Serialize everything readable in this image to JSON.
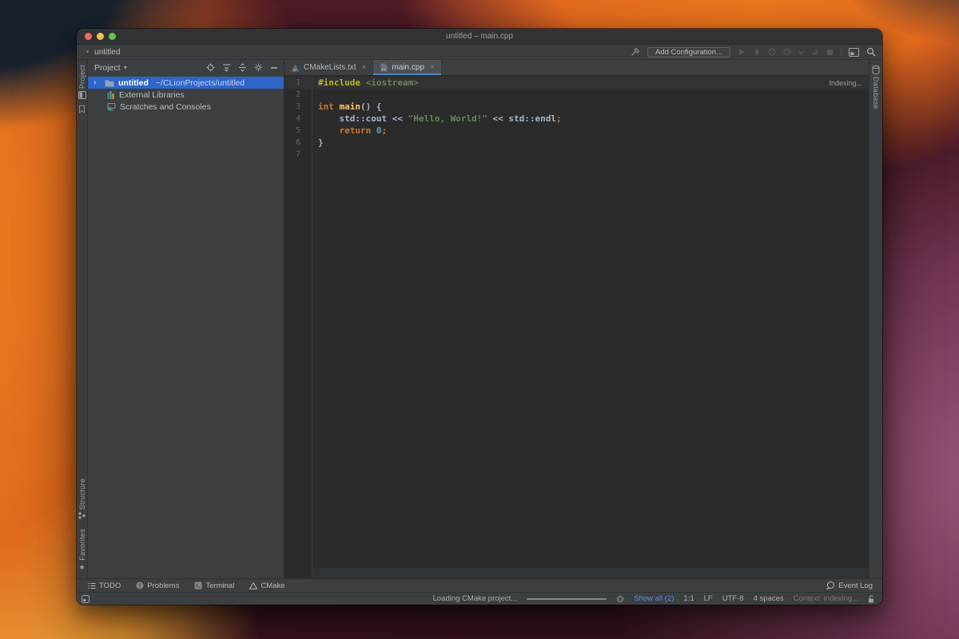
{
  "window": {
    "title": "untitled – main.cpp"
  },
  "toolbar": {
    "breadcrumb_dot": "•",
    "breadcrumb": "untitled",
    "add_configuration": "Add Configuration..."
  },
  "stripes": {
    "project": "Project",
    "structure": "Structure",
    "favorites": "Favorites",
    "database": "Database"
  },
  "project_panel": {
    "title": "Project",
    "caret": "▾",
    "chevron": "›",
    "items": [
      {
        "name": "untitled",
        "path": "~/CLionProjects/untitled"
      },
      {
        "name": "External Libraries"
      },
      {
        "name": "Scratches and Consoles"
      }
    ]
  },
  "tabs": [
    {
      "label": "CMakeLists.txt",
      "close": "×"
    },
    {
      "label": "main.cpp",
      "close": "×"
    }
  ],
  "editor": {
    "indexing": "Indexing...",
    "colors": {
      "background": "#2B2B2B",
      "caret_line": "#323232",
      "line_number": "#606366",
      "directive": "#BBB529",
      "string": "#6A8759",
      "keyword": "#CC7832",
      "function": "#FFC66D",
      "number": "#6897BB",
      "plain": "#A9B7C6"
    },
    "lines": [
      {
        "num": "1",
        "caret": true,
        "tokens": [
          {
            "t": "#include ",
            "s": "directive"
          },
          {
            "t": "<iostream>",
            "s": "string"
          }
        ]
      },
      {
        "num": "2",
        "tokens": []
      },
      {
        "num": "3",
        "tokens": [
          {
            "t": "int ",
            "s": "keyword"
          },
          {
            "t": "main",
            "s": "function"
          },
          {
            "t": "() {",
            "s": "plain"
          }
        ]
      },
      {
        "num": "4",
        "tokens": [
          {
            "t": "    std::cout << ",
            "s": "plain"
          },
          {
            "t": "\"Hello, World!\"",
            "s": "string"
          },
          {
            "t": " << std::endl",
            "s": "plain"
          },
          {
            "t": ";",
            "s": "keyword"
          }
        ]
      },
      {
        "num": "5",
        "tokens": [
          {
            "t": "    ",
            "s": "plain"
          },
          {
            "t": "return ",
            "s": "keyword"
          },
          {
            "t": "0",
            "s": "number"
          },
          {
            "t": ";",
            "s": "keyword"
          }
        ]
      },
      {
        "num": "6",
        "tokens": [
          {
            "t": "}",
            "s": "plain"
          }
        ]
      },
      {
        "num": "7",
        "tokens": []
      }
    ]
  },
  "bottom_bar": {
    "todo": "TODO",
    "problems": "Problems",
    "terminal": "Terminal",
    "cmake": "CMake",
    "event_log": "Event Log"
  },
  "status_bar": {
    "loading": "Loading CMake project...",
    "show_all": "Show all (2)",
    "caret_pos": "1:1",
    "line_sep": "LF",
    "encoding": "UTF-8",
    "indent": "4 spaces",
    "context": "Context: indexing..."
  },
  "colors": {
    "selection_blue": "#2D65C9",
    "tab_underline": "#4A88C7",
    "link_blue": "#5693DE",
    "traffic_red": "#EE6A5F",
    "traffic_yellow": "#F5BE4F",
    "traffic_green": "#61C554"
  }
}
